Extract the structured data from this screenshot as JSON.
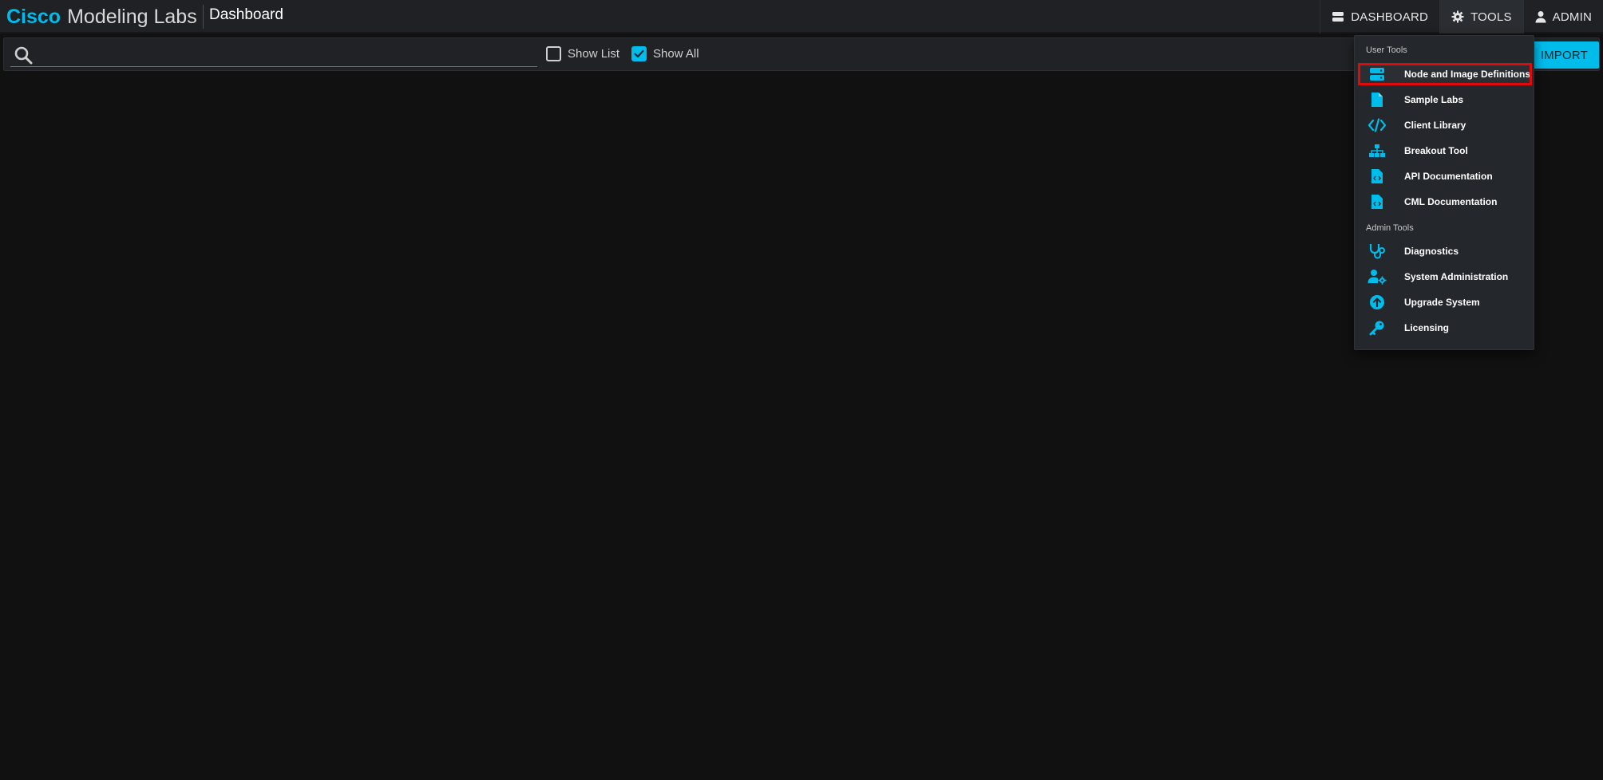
{
  "colors": {
    "accent": "#00bceb",
    "background": "#111111",
    "highlight_outline": "#e10a0a"
  },
  "header": {
    "brand_strong": "Cisco",
    "brand_rest": "Modeling Labs",
    "page_title": "Dashboard",
    "nav": {
      "dashboard_label": "DASHBOARD",
      "tools_label": "TOOLS",
      "admin_label": "ADMIN"
    }
  },
  "toolbar": {
    "search": {
      "value": "",
      "placeholder": ""
    },
    "show_list": {
      "label": "Show List",
      "checked": false
    },
    "show_all": {
      "label": "Show All",
      "checked": true
    },
    "import_label": "IMPORT"
  },
  "tools_menu": {
    "user_section_label": "User Tools",
    "admin_section_label": "Admin Tools",
    "user_items": [
      {
        "label": "Node and Image Definitions",
        "icon": "server-icon",
        "highlighted": true
      },
      {
        "label": "Sample Labs",
        "icon": "file-icon",
        "highlighted": false
      },
      {
        "label": "Client Library",
        "icon": "code-icon",
        "highlighted": false
      },
      {
        "label": "Breakout Tool",
        "icon": "sitemap-icon",
        "highlighted": false
      },
      {
        "label": "API Documentation",
        "icon": "file-code-icon",
        "highlighted": false
      },
      {
        "label": "CML Documentation",
        "icon": "file-code-icon",
        "highlighted": false
      }
    ],
    "admin_items": [
      {
        "label": "Diagnostics",
        "icon": "stethoscope-icon"
      },
      {
        "label": "System Administration",
        "icon": "user-gear-icon"
      },
      {
        "label": "Upgrade System",
        "icon": "arrow-up-circle-icon"
      },
      {
        "label": "Licensing",
        "icon": "key-icon"
      }
    ]
  }
}
